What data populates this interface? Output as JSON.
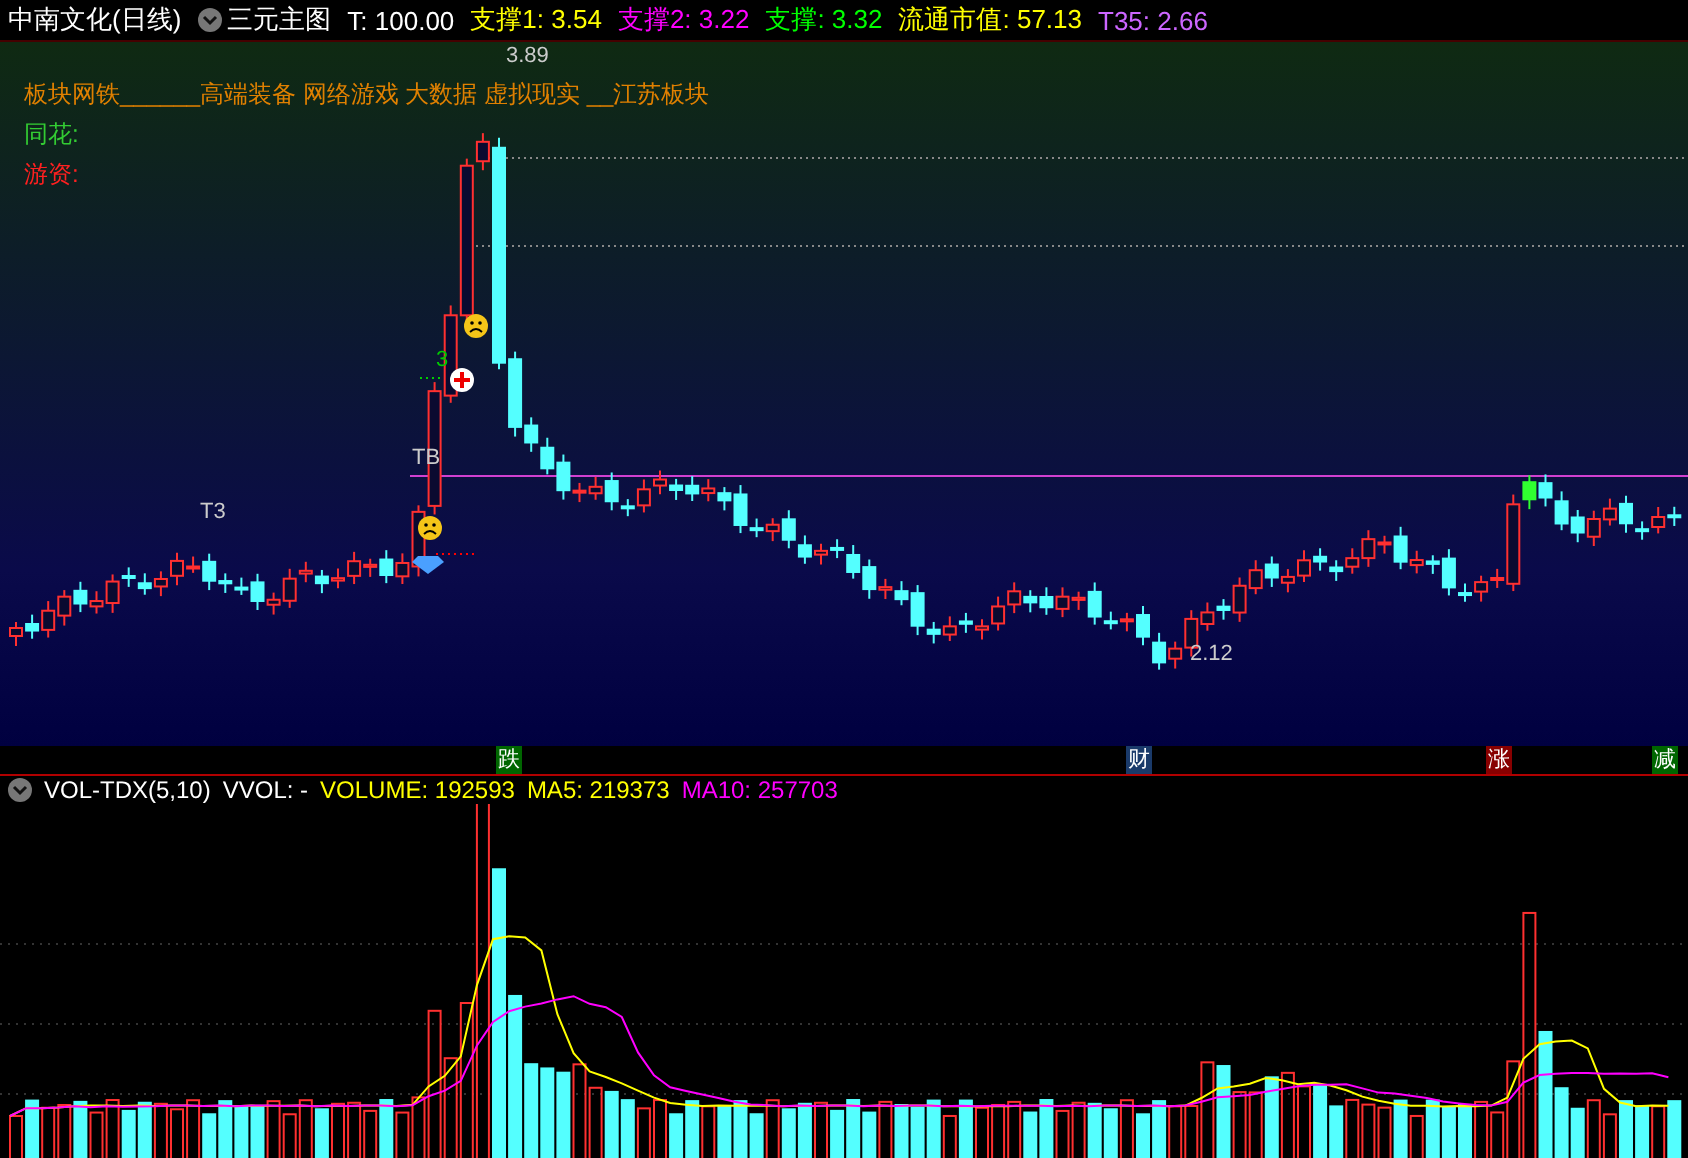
{
  "header": {
    "title": "中南文化(日线)",
    "indicator": "三元主图",
    "values": [
      {
        "text": "T: 100.00",
        "color": "#ffffff"
      },
      {
        "text": "支撑1: 3.54",
        "color": "#ffff00"
      },
      {
        "text": "支撑2: 3.22",
        "color": "#ff00ff"
      },
      {
        "text": "支撑: 3.32",
        "color": "#00ff00"
      },
      {
        "text": "流通市值: 57.13",
        "color": "#ffff00"
      },
      {
        "text": "T35: 2.66",
        "color": "#cc66ff"
      }
    ]
  },
  "notes": [
    {
      "text": "板块网铁______高端装备 网络游戏 大数据 虚拟现实 __江苏板块",
      "color": "#e08000"
    },
    {
      "text": "同花:",
      "color": "#33cc33"
    },
    {
      "text": "游资:",
      "color": "#ff2020"
    }
  ],
  "chart_labels": [
    {
      "text": "3.89"
    },
    {
      "text": "2.12"
    },
    {
      "text": "T3"
    },
    {
      "text": "TB"
    },
    {
      "text": "3"
    }
  ],
  "markers": [
    {
      "text": "跌",
      "color": "#006600"
    },
    {
      "text": "财",
      "color": "#1a3a6a"
    },
    {
      "text": "涨",
      "color": "#880000"
    },
    {
      "text": "减",
      "color": "#006600"
    }
  ],
  "volume_header": {
    "title": "VOL-TDX(5,10)",
    "values": [
      {
        "text": "VVOL: -",
        "color": "#ffffff"
      },
      {
        "text": "VOLUME: 192593",
        "color": "#ffff00"
      },
      {
        "text": "MA5: 219373",
        "color": "#ffff00"
      },
      {
        "text": "MA10: 257703",
        "color": "#ff00ff"
      }
    ]
  }
}
